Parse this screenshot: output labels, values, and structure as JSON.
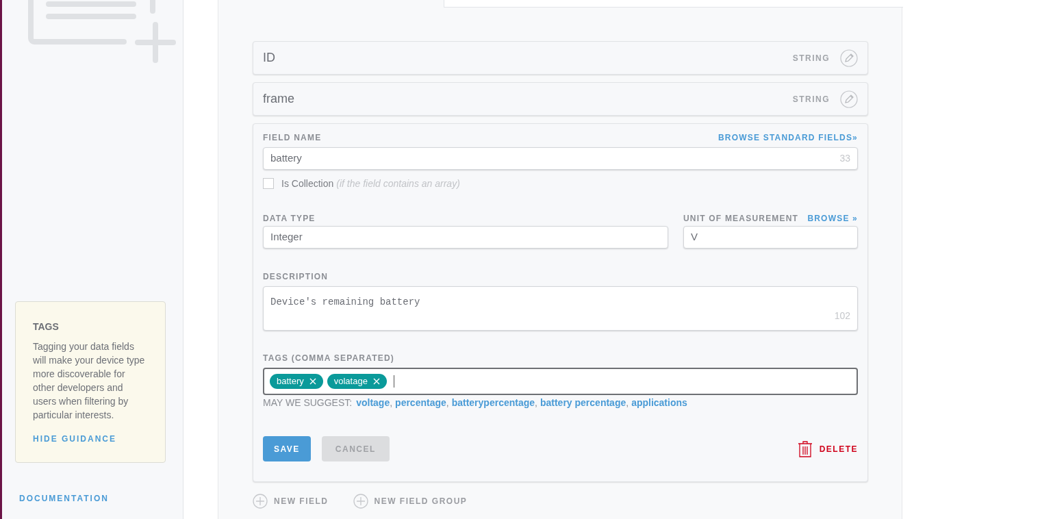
{
  "sidebar": {
    "guidance": {
      "title": "TAGS",
      "text": "Tagging your data fields will make your device type more discoverable for other developers and users when filtering by particular interests.",
      "hide_link": "HIDE GUIDANCE"
    },
    "documentation_heading": "DOCUMENTATION"
  },
  "fields": [
    {
      "name": "ID",
      "type": "STRING"
    },
    {
      "name": "frame",
      "type": "STRING"
    }
  ],
  "editor": {
    "field_name_label": "FIELD NAME",
    "browse_standard": "BROWSE STANDARD FIELDS»",
    "field_name": "battery",
    "field_name_count": "33",
    "is_collection": {
      "label": "Is Collection",
      "hint": "(if the field contains an array)",
      "checked": false
    },
    "data_type_label": "DATA TYPE",
    "data_type": "Integer",
    "unit_label": "UNIT OF MEASUREMENT",
    "unit_browse": "BROWSE »",
    "unit": "V",
    "description_label": "DESCRIPTION",
    "description": "Device's remaining battery",
    "description_count": "102",
    "tags_label": "TAGS (COMMA SEPARATED)",
    "tags": [
      "battery",
      "volatage"
    ],
    "suggest_label": "MAY WE SUGGEST:",
    "suggestions": [
      "voltage",
      "percentage",
      "batterypercentage",
      "battery percentage",
      "applications"
    ],
    "separator": ",",
    "save": "SAVE",
    "cancel": "CANCEL",
    "delete": "DELETE"
  },
  "add_actions": [
    "NEW FIELD",
    "NEW FIELD GROUP"
  ]
}
